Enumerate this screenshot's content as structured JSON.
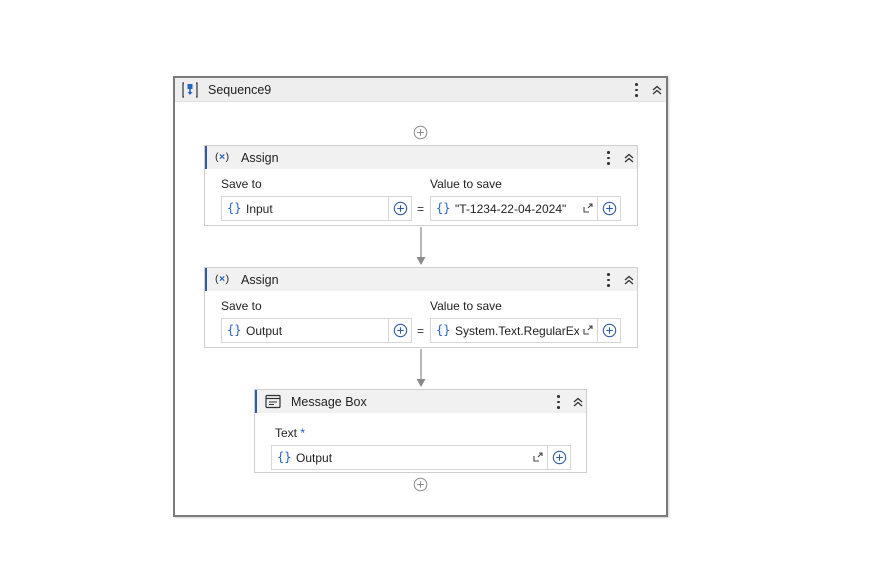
{
  "sequence": {
    "title": "Sequence9"
  },
  "activities": [
    {
      "title": "Assign",
      "icon_text": "(x)",
      "save_to_label": "Save to",
      "value_label": "Value to save",
      "save_to_value": "Input",
      "value_to_save": "\"T-1234-22-04-2024\"",
      "equals": "="
    },
    {
      "title": "Assign",
      "icon_text": "(x)",
      "save_to_label": "Save to",
      "value_label": "Value to save",
      "save_to_value": "Output",
      "value_to_save": "System.Text.RegularEx",
      "equals": "="
    }
  ],
  "message_box": {
    "title": "Message Box",
    "text_label": "Text",
    "required_mark": "*",
    "text_value": "Output"
  },
  "braces": "{}",
  "colors": {
    "accent": "#2463c8",
    "header_bg": "#f1f1f1",
    "border": "#7a7a7a"
  },
  "icons": [
    "sequence-icon",
    "kebab-menu-icon",
    "collapse-icon",
    "add-activity-icon",
    "assign-icon",
    "message-box-icon",
    "expand-icon",
    "plus-icon"
  ]
}
